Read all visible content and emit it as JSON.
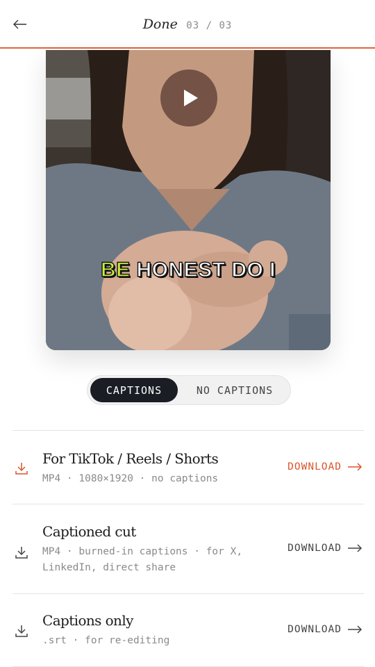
{
  "header": {
    "title": "Done",
    "step": "03 / 03",
    "back_icon": "arrow-left-icon"
  },
  "video": {
    "play_icon": "play-icon",
    "caption_highlight": "BE",
    "caption_rest": " HONEST DO I"
  },
  "toggle": {
    "options": [
      "CAPTIONS",
      "NO CAPTIONS"
    ],
    "selected": "CAPTIONS"
  },
  "downloads": [
    {
      "title": "For TikTok / Reels / Shorts",
      "meta": "MP4 · 1080×1920 · no captions",
      "action": "DOWNLOAD",
      "accent": true
    },
    {
      "title": "Captioned cut",
      "meta": "MP4 · burned-in captions · for X, LinkedIn, direct share",
      "action": "DOWNLOAD",
      "accent": false
    },
    {
      "title": "Captions only",
      "meta": ".srt · for re-editing",
      "action": "DOWNLOAD",
      "accent": false
    }
  ],
  "colors": {
    "accent": "#e0643c",
    "caption_highlight": "#c8f03c",
    "toggle_active_bg": "#1a1d24"
  }
}
